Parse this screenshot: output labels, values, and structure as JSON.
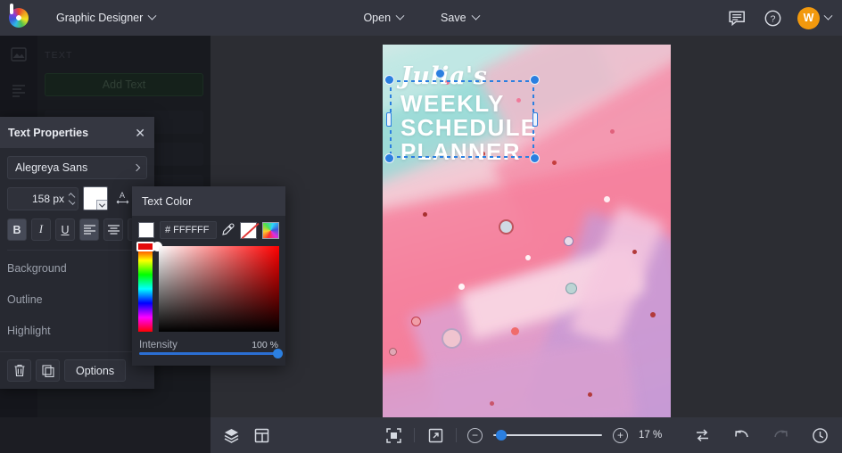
{
  "topbar": {
    "document_title": "Graphic Designer",
    "open_label": "Open",
    "save_label": "Save",
    "chat_icon": "chat-icon",
    "help_icon": "help-icon",
    "avatar_initial": "W"
  },
  "left_rail": {
    "icons": [
      "image-tool-icon",
      "text-tool-icon",
      "frame-tool-icon"
    ]
  },
  "text_panel": {
    "section_label": "TEXT",
    "add_text_label": "Add Text"
  },
  "text_properties": {
    "title": "Text Properties",
    "close_icon": "close-icon",
    "font_family": "Alegreya Sans",
    "font_size": "158 px",
    "color_swatch": "#FFFFFF",
    "letter_spacing_icon": "letter-spacing-icon",
    "bold_label": "B",
    "italic_label": "I",
    "underline_label": "U",
    "align_left_icon": "align-left-icon",
    "align_center_icon": "align-center-icon",
    "align_right_icon": "align-right-icon",
    "rows": [
      {
        "label": "Background",
        "value": "none"
      },
      {
        "label": "Outline",
        "value": "none"
      },
      {
        "label": "Highlight",
        "value": "none"
      }
    ],
    "delete_icon": "trash-icon",
    "duplicate_icon": "duplicate-icon",
    "options_label": "Options"
  },
  "text_color_popup": {
    "title": "Text Color",
    "hex_value": "# FFFFFF",
    "eyedropper_icon": "eyedropper-icon",
    "none_swatch_icon": "no-color-icon",
    "palette_icon": "color-wheel-icon",
    "intensity_label": "Intensity",
    "intensity_value": "100 %"
  },
  "canvas": {
    "script_text": "Julia's",
    "heading_line1": "WEEKLY",
    "heading_line2": "SCHEDULE",
    "heading_line3": "PLANNER"
  },
  "bottom_bar": {
    "layers_icon": "layers-icon",
    "page_layout_icon": "page-layout-icon",
    "fit_screen_icon": "fit-to-screen-icon",
    "fullscreen_icon": "fullscreen-icon",
    "zoom_out_label": "−",
    "zoom_in_label": "+",
    "zoom_level": "17 %",
    "compare_icon": "compare-icon",
    "undo_icon": "undo-icon",
    "redo_icon": "redo-icon",
    "history_icon": "history-icon"
  },
  "colors": {
    "accent_blue": "#2b7fe0",
    "avatar_orange": "#f2990d",
    "topbar": "#33353f",
    "panel": "#272931"
  }
}
